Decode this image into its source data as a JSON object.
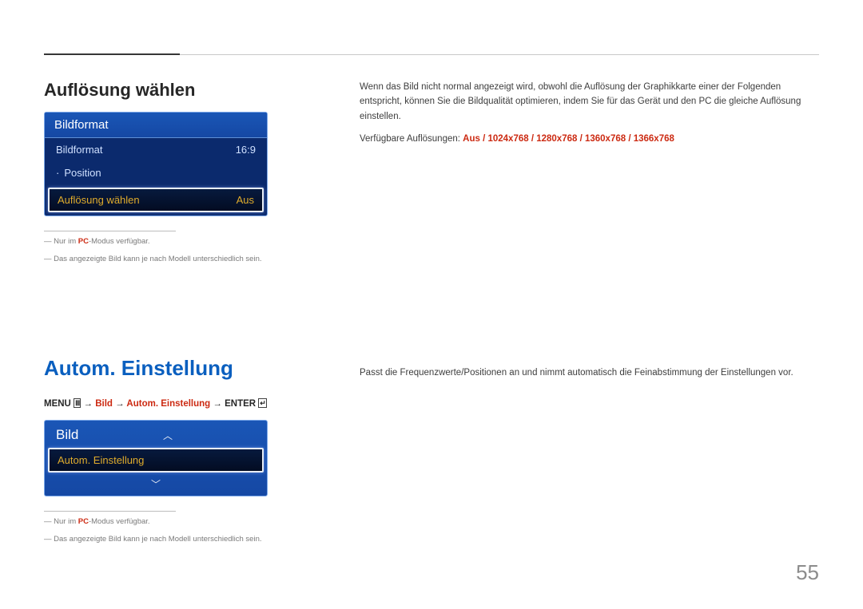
{
  "section1": {
    "heading": "Auflösung wählen",
    "panel": {
      "title": "Bildformat",
      "row1_label": "Bildformat",
      "row1_value": "16:9",
      "row2_label": "Position",
      "row3_label": "Auflösung wählen",
      "row3_value": "Aus"
    },
    "foot1_pre": "Nur im ",
    "foot1_red": "PC",
    "foot1_post": "-Modus verfügbar.",
    "foot2": "Das angezeigte Bild kann je nach Modell unterschiedlich sein.",
    "body_p1": "Wenn das Bild nicht normal angezeigt wird, obwohl die Auflösung der Graphikkarte einer der Folgenden entspricht, können Sie die Bildqualität optimieren, indem Sie für das Gerät und den PC die gleiche Auflösung einstellen.",
    "body_p2_pre": "Verfügbare Auflösungen: ",
    "body_p2_red": "Aus / 1024x768 / 1280x768 / 1360x768 / 1366x768"
  },
  "section2": {
    "heading": "Autom. Einstellung",
    "crumb_menu": "MENU",
    "crumb_bild": "Bild",
    "crumb_auto": "Autom. Einstellung",
    "crumb_enter": "ENTER",
    "arrow": "→",
    "panel_title": "Bild",
    "panel_selected": "Autom. Einstellung",
    "foot1_pre": "Nur im ",
    "foot1_red": "PC",
    "foot1_post": "-Modus verfügbar.",
    "foot2": "Das angezeigte Bild kann je nach Modell unterschiedlich sein.",
    "body": "Passt die Frequenzwerte/Positionen an und nimmt automatisch die Feinabstimmung der Einstellungen vor."
  },
  "page": "55"
}
